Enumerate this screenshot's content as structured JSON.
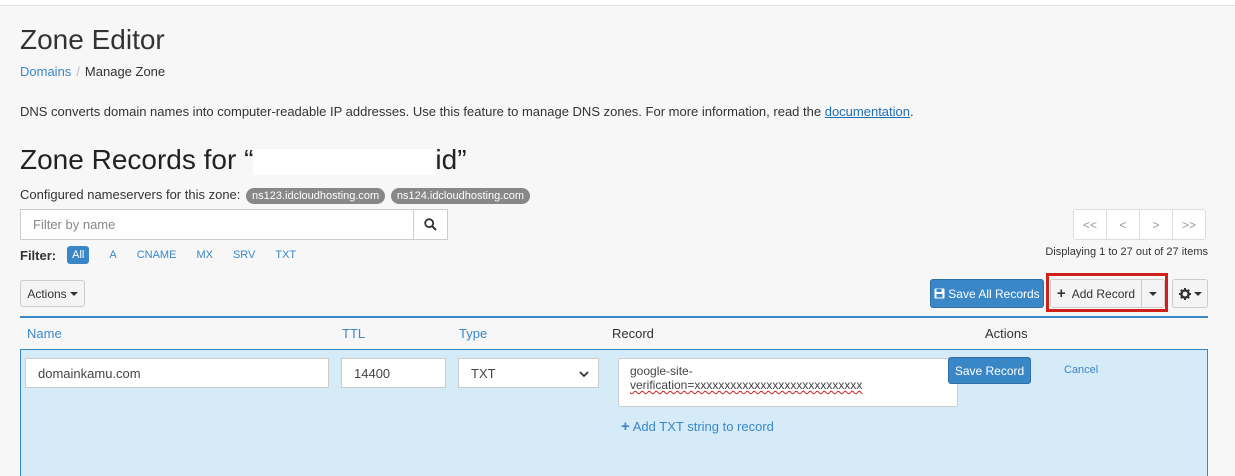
{
  "page": {
    "title": "Zone Editor",
    "breadcrumb": {
      "link": "Domains",
      "current": "Manage Zone"
    },
    "description": "DNS converts domain names into computer-readable IP addresses. Use this feature to manage DNS zones. For more information, read the ",
    "description_link": "documentation",
    "description_end": "."
  },
  "zone": {
    "title_prefix": "Zone Records for “",
    "title_suffix": "id”",
    "ns_label": "Configured nameservers for this zone:",
    "nameservers": [
      "ns123.idcloudhosting.com",
      "ns124.idcloudhosting.com"
    ]
  },
  "search": {
    "placeholder": "Filter by name"
  },
  "pagination": {
    "first": "<<",
    "prev": "<",
    "next": ">",
    "last": ">>",
    "display": "Displaying 1 to 27 out of 27 items"
  },
  "filter": {
    "label": "Filter:",
    "options": [
      "All",
      "A",
      "CNAME",
      "MX",
      "SRV",
      "TXT"
    ],
    "active": "All"
  },
  "toolbar": {
    "actions_label": "Actions",
    "save_all_label": "Save All Records",
    "add_record_label": "Add Record"
  },
  "table": {
    "headers": {
      "name": "Name",
      "ttl": "TTL",
      "type": "Type",
      "record": "Record",
      "actions": "Actions"
    }
  },
  "edit_row": {
    "name": "domainkamu.com",
    "ttl": "14400",
    "type": "TXT",
    "record_line1": "google-site-",
    "record_line2": "verification=xxxxxxxxxxxxxxxxxxxxxxxxxxxx",
    "save_label": "Save Record",
    "cancel_label": "Cancel",
    "add_txt_label": "Add TXT string to record"
  },
  "colors": {
    "accent": "#3a87c8",
    "highlight": "#d0201b",
    "row_bg": "#d6ebf8"
  }
}
